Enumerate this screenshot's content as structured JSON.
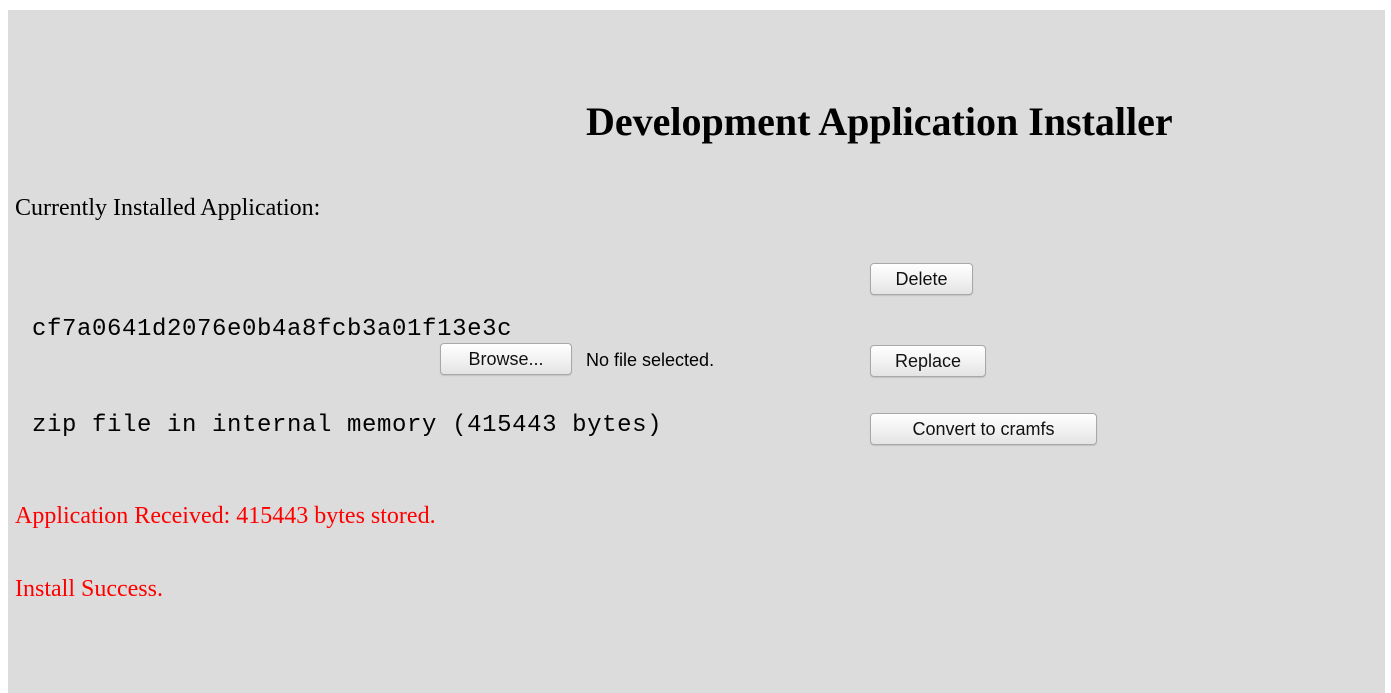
{
  "header": {
    "title": "Development Application Installer"
  },
  "installed": {
    "label": "Currently Installed Application:",
    "app_id": "cf7a0641d2076e0b4a8fcb3a01f13e3c",
    "description": "zip file in internal memory (415443 bytes)"
  },
  "actions": {
    "delete_label": "Delete",
    "browse_label": "Browse...",
    "file_status": "No file selected.",
    "replace_label": "Replace",
    "convert_label": "Convert to cramfs"
  },
  "messages": {
    "received": "Application Received: 415443 bytes stored.",
    "success": "Install Success."
  },
  "colors": {
    "background": "#dcdcdc",
    "message": "#ff0000"
  }
}
